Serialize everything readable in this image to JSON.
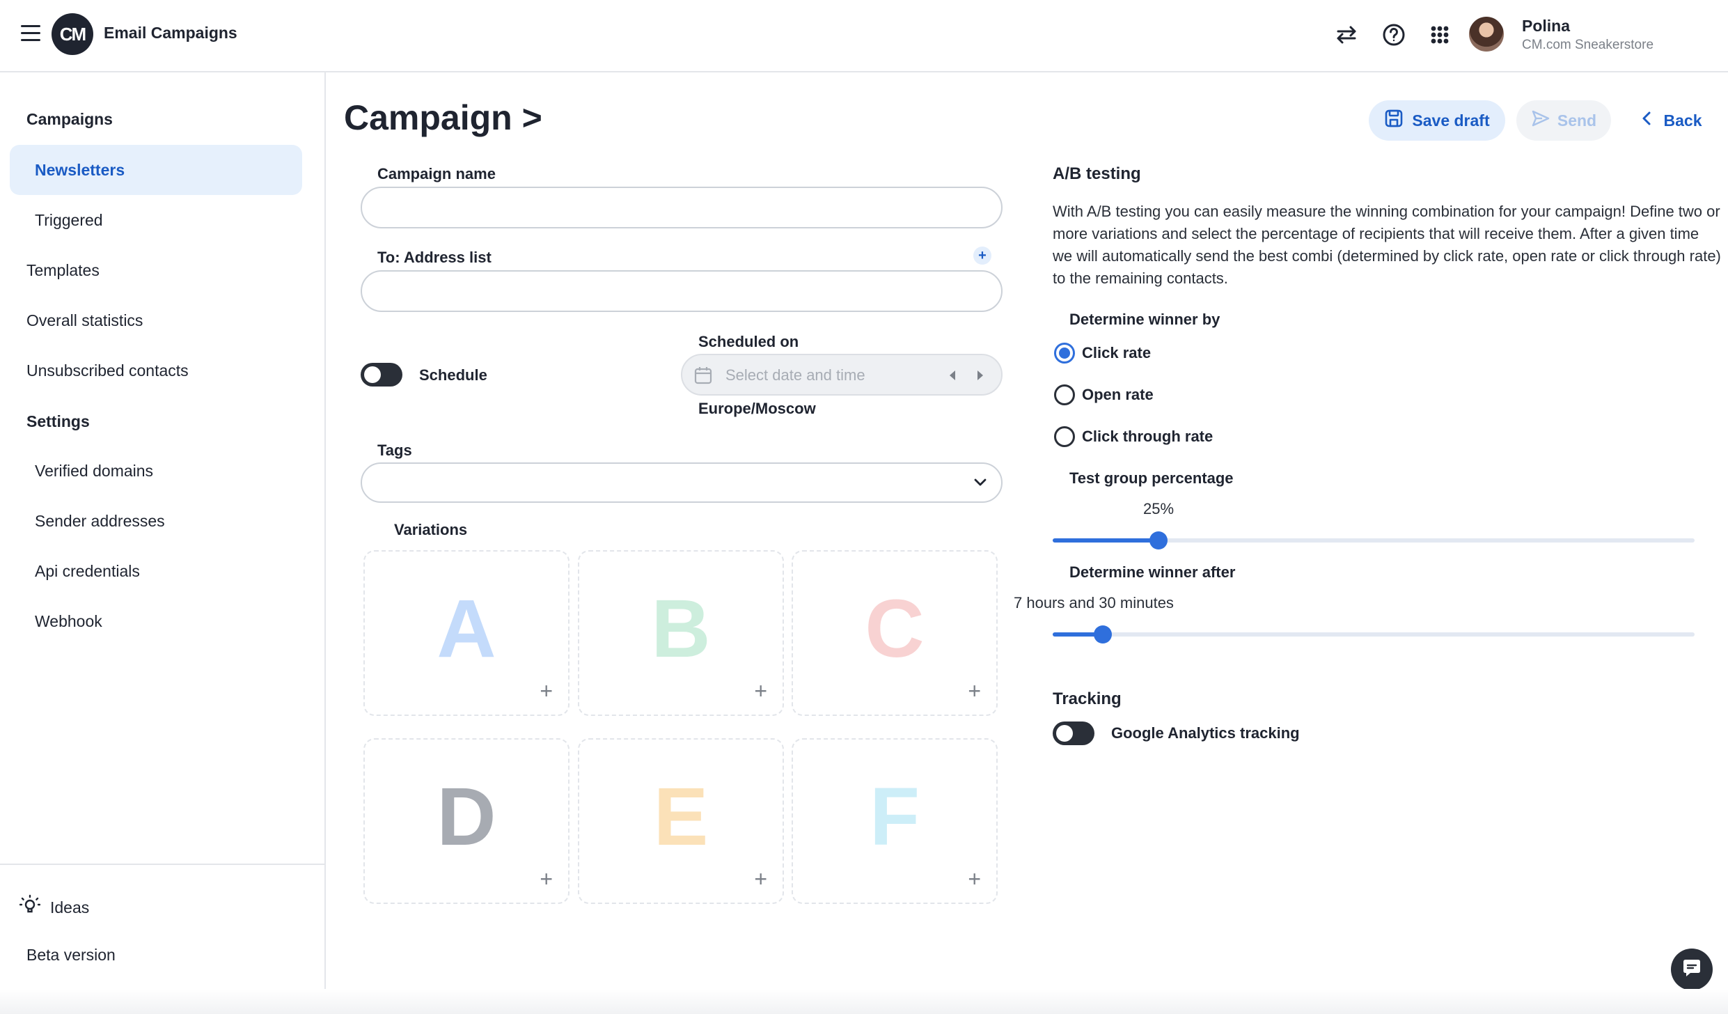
{
  "header": {
    "logo_text": "CM",
    "app_title": "Email Campaigns",
    "user_name": "Polina",
    "user_org": "CM.com Sneakerstore",
    "icons": [
      "menu-icon",
      "switch-icon",
      "help-icon",
      "apps-grid-icon"
    ]
  },
  "sidebar": {
    "campaigns_heading": "Campaigns",
    "campaign_items": [
      {
        "label": "Newsletters",
        "active": true
      },
      {
        "label": "Triggered",
        "active": false
      }
    ],
    "top_items": [
      {
        "label": "Templates"
      },
      {
        "label": "Overall statistics"
      },
      {
        "label": "Unsubscribed contacts"
      }
    ],
    "settings_heading": "Settings",
    "settings_items": [
      {
        "label": "Verified domains"
      },
      {
        "label": "Sender addresses"
      },
      {
        "label": "Api credentials"
      },
      {
        "label": "Webhook"
      }
    ],
    "ideas_label": "Ideas",
    "beta_label": "Beta version"
  },
  "page": {
    "title": "Campaign >",
    "save_draft": "Save draft",
    "send": "Send",
    "back": "Back"
  },
  "form": {
    "campaign_name_label": "Campaign name",
    "campaign_name_value": "",
    "address_list_label": "To: Address list",
    "address_list_value": "",
    "schedule_label": "Schedule",
    "schedule_on": false,
    "scheduled_on_label": "Scheduled on",
    "date_placeholder": "Select date and time",
    "timezone": "Europe/Moscow",
    "tags_label": "Tags",
    "variations_label": "Variations",
    "variations": [
      {
        "letter": "A",
        "color": "#c4dbfb"
      },
      {
        "letter": "B",
        "color": "#cdeedd"
      },
      {
        "letter": "C",
        "color": "#f8d2d2"
      },
      {
        "letter": "D",
        "color": "#a7abb2"
      },
      {
        "letter": "E",
        "color": "#fbe1b8"
      },
      {
        "letter": "F",
        "color": "#cdeef8"
      }
    ]
  },
  "ab_testing": {
    "title": "A/B testing",
    "description": "With A/B testing you can easily measure the winning combination for your campaign! Define two or more variations and select the percentage of recipients that will receive them. After a given time we will automatically send the best combi (determined by click rate, open rate or click through rate) to the remaining contacts.",
    "winner_by_label": "Determine winner by",
    "options": [
      {
        "label": "Click rate",
        "checked": true
      },
      {
        "label": "Open rate",
        "checked": false
      },
      {
        "label": "Click through rate",
        "checked": false
      }
    ],
    "test_group_label": "Test group percentage",
    "test_group_value": "25%",
    "test_group_fraction": 0.165,
    "winner_after_label": "Determine winner after",
    "winner_after_value": "7 hours and 30 minutes",
    "winner_after_fraction": 0.078
  },
  "tracking": {
    "title": "Tracking",
    "ga_label": "Google Analytics tracking",
    "ga_on": false
  },
  "colors": {
    "accent": "#2f6fdc",
    "link": "#1a5bc4",
    "active_bg": "#e6f0fc",
    "dark": "#1f2430"
  }
}
